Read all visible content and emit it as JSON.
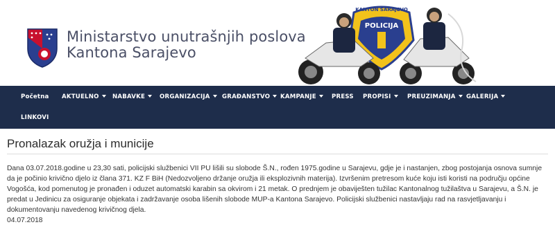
{
  "header": {
    "title_line1": "Ministarstvo unutrašnjih poslova",
    "title_line2": "Kantona Sarajevo",
    "badge_text": "KANTON SARAJEVO",
    "badge_word": "POLICIJA",
    "colors": {
      "crest_blue": "#2a3f8f",
      "crest_red": "#c8102e",
      "badge_yellow": "#f2c21b"
    }
  },
  "nav": {
    "items": [
      {
        "label": "Početna",
        "dropdown": false
      },
      {
        "label": "AKTUELNO",
        "dropdown": true
      },
      {
        "label": "NABAVKE",
        "dropdown": true
      },
      {
        "label": "ORGANIZACIJA",
        "dropdown": true
      },
      {
        "label": "GRAĐANSTVO",
        "dropdown": true
      },
      {
        "label": "KAMPANJE",
        "dropdown": true
      },
      {
        "label": "PRESS",
        "dropdown": false
      },
      {
        "label": "PROPISI",
        "dropdown": true
      },
      {
        "label": "PREUZIMANJA",
        "dropdown": true
      },
      {
        "label": "GALERIJA",
        "dropdown": true
      },
      {
        "label": "LINKOVI",
        "dropdown": false
      }
    ],
    "color": "#1e2d4b"
  },
  "article": {
    "title": "Pronalazak oružja i municije",
    "body": "Dana 03.07.2018.godine u 23,30 sati, policijski službenici VII PU lišili su slobode Š.N., rođen 1975.godine u Sarajevu, gdje je i nastanjen, zbog postojanja osnova sumnje da je počinio krivično djelo iz člana 371. KZ F BiH (Nedozvoljeno držanje oružja ili eksplozivnih materija). Izvršenim pretresom kuće koju isti koristi na području općine Vogošća, kod pomenutog je pronađen i oduzet automatski karabin sa okvirom i 21 metak. O prednjem je obaviješten tužilac Kantonalnog tužilaštva u Sarajevu, a Š.N. je predat u Jedinicu za osiguranje objekata i zadržavanje osoba lišenih slobode MUP-a Kantona Sarajevo. Policijski službenici nastavljaju rad na rasvjetljavanju i dokumentovanju navedenog krivičnog djela.",
    "date": "04.07.2018"
  }
}
